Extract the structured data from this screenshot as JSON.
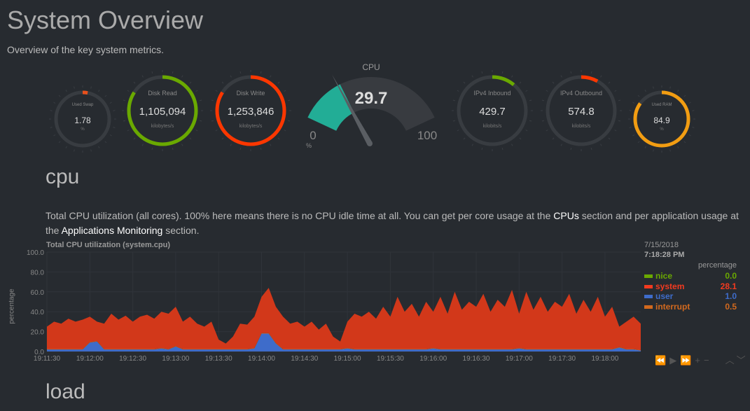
{
  "page": {
    "title": "System Overview",
    "subtitle": "Overview of the key system metrics."
  },
  "gauges": [
    {
      "id": "swap",
      "title": "Used Swap",
      "value": "1.78",
      "units": "%",
      "fraction": 0.0178,
      "color": "#e8501c",
      "size": "small"
    },
    {
      "id": "disk-read",
      "title": "Disk Read",
      "value": "1,105,094",
      "units": "kilobytes/s",
      "fraction": 0.84,
      "color": "#6aa900",
      "size": "large"
    },
    {
      "id": "disk-write",
      "title": "Disk Write",
      "value": "1,253,846",
      "units": "kilobytes/s",
      "fraction": 0.84,
      "color": "#fd3700",
      "size": "large"
    },
    {
      "id": "ipv4-in",
      "title": "IPv4 Inbound",
      "value": "429.7",
      "units": "kilobits/s",
      "fraction": 0.11,
      "color": "#6aa900",
      "size": "large"
    },
    {
      "id": "ipv4-out",
      "title": "IPv4 Outbound",
      "value": "574.8",
      "units": "kilobits/s",
      "fraction": 0.08,
      "color": "#fd3700",
      "size": "large"
    },
    {
      "id": "ram",
      "title": "Used RAM",
      "value": "84.9",
      "units": "%",
      "fraction": 0.849,
      "color": "#f29d12",
      "size": "small"
    }
  ],
  "cpu_gauge": {
    "title": "CPU",
    "value": "29.7",
    "min": "0",
    "max": "100",
    "units": "%",
    "percent": 29.7,
    "color": "#22ad96"
  },
  "sections": {
    "cpu": "cpu",
    "load": "load"
  },
  "cpu_desc": {
    "p1": "Total CPU utilization (all cores). 100% here means there is no CPU idle time at all. You can get per core usage at the ",
    "link1": "CPUs",
    "p2": " section and per application usage at the ",
    "link2": "Applications Monitoring",
    "p3": " section."
  },
  "legend": {
    "date": "7/15/2018",
    "time": "7:18:28 PM",
    "units": "percentage",
    "items": [
      {
        "name": "nice",
        "value": "0.0",
        "color": "#6aa900"
      },
      {
        "name": "system",
        "value": "28.1",
        "color": "#f33a1f"
      },
      {
        "name": "user",
        "value": "1.0",
        "color": "#3e6cca"
      },
      {
        "name": "interrupt",
        "value": "0.5",
        "color": "#d2691e"
      }
    ]
  },
  "nav": {
    "buttons": [
      "⏪",
      "▶",
      "⏩",
      "+",
      "−",
      "︿﹀"
    ]
  },
  "chart_data": {
    "type": "area",
    "stacked": true,
    "title": "Total CPU utilization (system.cpu)",
    "ylabel": "percentage",
    "ylim": [
      0,
      100
    ],
    "yticks": [
      "0.0",
      "20.0",
      "40.0",
      "60.0",
      "80.0",
      "100.0"
    ],
    "xticks": [
      "19:11:30",
      "19:12:00",
      "19:12:30",
      "19:13:00",
      "19:13:30",
      "19:14:00",
      "19:14:30",
      "19:15:00",
      "19:15:30",
      "19:16:00",
      "19:16:30",
      "19:17:00",
      "19:17:30",
      "19:18:00"
    ],
    "x_start": "19:11:30",
    "step_seconds": 5,
    "grid": true,
    "series": [
      {
        "name": "user",
        "color": "#3e6cca",
        "values": [
          2,
          2,
          2,
          2,
          2,
          2,
          9,
          10,
          2,
          2,
          2,
          2,
          2,
          2,
          2,
          2,
          3,
          2,
          5,
          2,
          2,
          2,
          2,
          2,
          2,
          2,
          2,
          2,
          2,
          3,
          18,
          18,
          8,
          2,
          2,
          2,
          2,
          2,
          2,
          2,
          2,
          2,
          3,
          2,
          2,
          2,
          2,
          2,
          2,
          2,
          2,
          2,
          2,
          2,
          3,
          2,
          2,
          2,
          2,
          2,
          2,
          2,
          2,
          2,
          2,
          2,
          3,
          2,
          2,
          2,
          2,
          2,
          2,
          2,
          2,
          2,
          2,
          2,
          2,
          2,
          4,
          2,
          2,
          1
        ]
      },
      {
        "name": "interrupt",
        "color": "#d2691e",
        "values": [
          0.5,
          0.5,
          0.5,
          0.5,
          0.5,
          0.5,
          0.5,
          0.5,
          0.5,
          0.5,
          0.5,
          0.5,
          0.5,
          0.5,
          0.5,
          0.5,
          0.5,
          0.5,
          0.5,
          0.5,
          0.5,
          0.5,
          0.5,
          0.5,
          0.5,
          0.5,
          0.5,
          0.5,
          0.5,
          0.5,
          0.5,
          0.5,
          0.5,
          0.5,
          0.5,
          0.5,
          0.5,
          0.5,
          0.5,
          0.5,
          0.5,
          0.5,
          0.5,
          0.5,
          0.5,
          0.5,
          0.5,
          0.5,
          0.5,
          0.5,
          0.5,
          0.5,
          0.5,
          0.5,
          0.5,
          0.5,
          0.5,
          0.5,
          0.5,
          0.5,
          0.5,
          0.5,
          0.5,
          0.5,
          0.5,
          0.5,
          0.5,
          0.5,
          0.5,
          0.5,
          0.5,
          0.5,
          0.5,
          0.5,
          0.5,
          0.5,
          0.5,
          0.5,
          0.5,
          0.5,
          0.5,
          0.5,
          0.5,
          0.5
        ]
      },
      {
        "name": "system",
        "color": "#d2381a",
        "values": [
          22.5,
          27.5,
          25.5,
          30.5,
          27.5,
          29.5,
          25.5,
          19.5,
          25.5,
          35.5,
          29.5,
          33.5,
          27.5,
          32.5,
          34.5,
          30.5,
          36.5,
          35.5,
          39.5,
          27.5,
          32.5,
          25.5,
          22.5,
          27.5,
          9.5,
          5.5,
          12.5,
          25.5,
          24.5,
          31.5,
          36.5,
          45.5,
          36.5,
          32.5,
          25.5,
          27.5,
          22.5,
          27.5,
          19.5,
          25.5,
          12.5,
          7.5,
          26.5,
          35.5,
          32.5,
          37.5,
          30.5,
          42.5,
          32.5,
          52.5,
          37.5,
          45.5,
          32.5,
          47.5,
          36.5,
          52.5,
          35.5,
          57.5,
          39.5,
          47.5,
          42.5,
          55.5,
          37.5,
          49.5,
          42.5,
          59.5,
          34.5,
          57.5,
          39.5,
          52.5,
          37.5,
          47.5,
          42.5,
          55.5,
          35.5,
          49.5,
          37.5,
          52.5,
          32.5,
          42.5,
          20.5,
          27.5,
          32.5,
          26.5
        ]
      },
      {
        "name": "nice",
        "color": "#6aa900",
        "values": [
          0,
          0,
          0,
          0,
          0,
          0,
          0,
          0,
          0,
          0,
          0,
          0,
          0,
          0,
          0,
          0,
          0,
          0,
          0,
          0,
          0,
          0,
          0,
          0,
          0,
          0,
          0,
          0,
          0,
          0,
          0,
          0,
          0,
          0,
          0,
          0,
          0,
          0,
          0,
          0,
          0,
          0,
          0,
          0,
          0,
          0,
          0,
          0,
          0,
          0,
          0,
          0,
          0,
          0,
          0,
          0,
          0,
          0,
          0,
          0,
          0,
          0,
          0,
          0,
          0,
          0,
          0,
          0,
          0,
          0,
          0,
          0,
          0,
          0,
          0,
          0,
          0,
          0,
          0,
          0,
          0,
          0,
          0,
          0
        ]
      }
    ]
  }
}
